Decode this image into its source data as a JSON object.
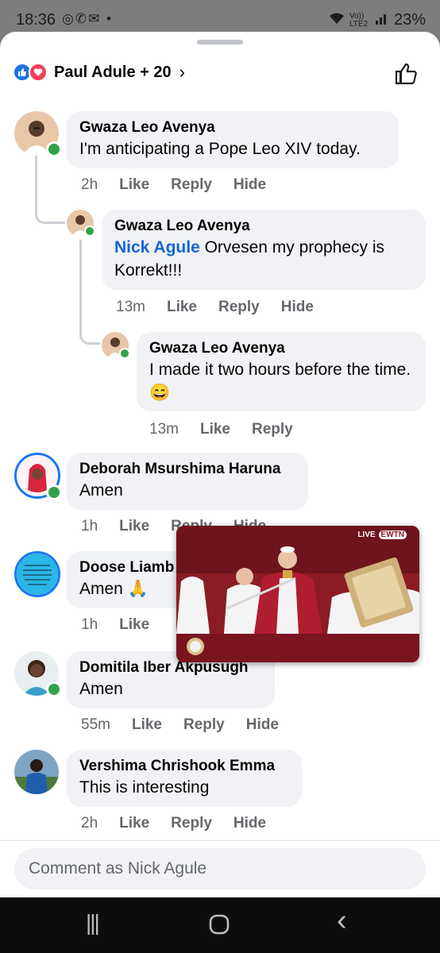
{
  "status": {
    "time": "18:36",
    "notif_icons": "◎✆✉ •",
    "network": "Vo)) LTE2",
    "battery": "23%"
  },
  "header": {
    "reactors": "Paul Adule + 20",
    "chevron": "›"
  },
  "comments": [
    {
      "name": "Gwaza Leo Avenya",
      "text": "I'm anticipating a Pope Leo XIV today.",
      "time": "2h",
      "like": "Like",
      "reply": "Reply",
      "hide": "Hide"
    },
    {
      "name": "Gwaza Leo Avenya",
      "mention": "Nick Agule",
      "text": "Orvesen my prophecy is Korrekt!!!",
      "time": "13m",
      "like": "Like",
      "reply": "Reply",
      "hide": "Hide"
    },
    {
      "name": "Gwaza Leo Avenya",
      "text": "I made it two hours before the time.😄",
      "time": "13m",
      "like": "Like",
      "reply": "Reply"
    },
    {
      "name": "Deborah Msurshima Haruna",
      "text": "Amen",
      "time": "1h",
      "like": "Like",
      "reply": "Reply",
      "hide": "Hide"
    },
    {
      "name": "Doose Liamb",
      "text": "Amen 🙏",
      "time": "1h",
      "like": "Like"
    },
    {
      "name": "Domitila Iber Akpusugh",
      "text": "Amen",
      "time": "55m",
      "like": "Like",
      "reply": "Reply",
      "hide": "Hide"
    },
    {
      "name": "Vershima Chrishook Emma",
      "text": "This is interesting",
      "time": "2h",
      "like": "Like",
      "reply": "Reply",
      "hide": "Hide"
    }
  ],
  "video": {
    "badge": "LIVE",
    "channel": "EWTN"
  },
  "composer": {
    "placeholder": "Comment as Nick Agule"
  },
  "nav": {
    "recents": "|||",
    "home": "◯",
    "back": "‹"
  },
  "colors": {
    "like_blue": "#1b74e4",
    "love_red": "#f33e58",
    "online_green": "#31a24c",
    "mention_blue": "#1565d8"
  }
}
